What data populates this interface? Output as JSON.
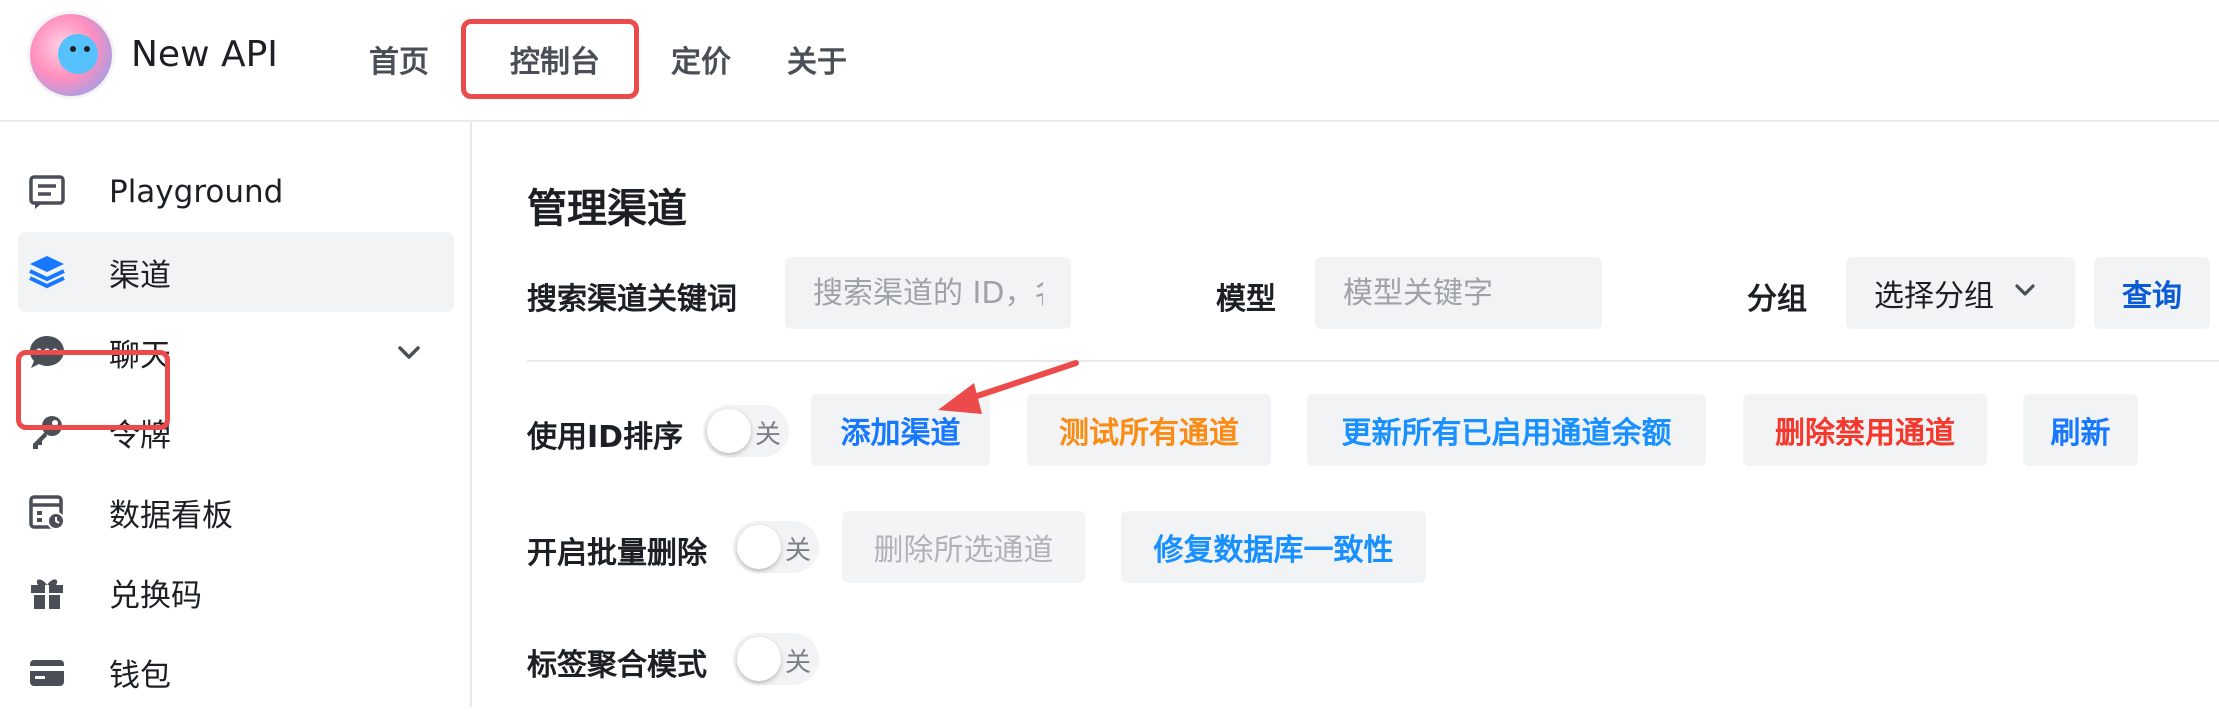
{
  "app": {
    "brand": "New API"
  },
  "topnav": {
    "items": [
      {
        "label": "首页"
      },
      {
        "label": "控制台",
        "active": true
      },
      {
        "label": "定价"
      },
      {
        "label": "关于"
      }
    ]
  },
  "sidebar": {
    "items": [
      {
        "label": "Playground",
        "icon": "chat-square-icon"
      },
      {
        "label": "渠道",
        "icon": "layers-icon",
        "active": true
      },
      {
        "label": "聊天",
        "icon": "chat-bubble-icon",
        "expandable": true
      },
      {
        "label": "令牌",
        "icon": "key-icon"
      },
      {
        "label": "数据看板",
        "icon": "dashboard-icon"
      },
      {
        "label": "兑换码",
        "icon": "gift-icon"
      },
      {
        "label": "钱包",
        "icon": "wallet-icon"
      }
    ]
  },
  "main": {
    "title": "管理渠道",
    "filters": {
      "keyword_label": "搜索渠道关键词",
      "keyword_placeholder": "搜索渠道的 ID，名称和密钥 ...",
      "model_label": "模型",
      "model_placeholder": "模型关键字",
      "group_label": "分组",
      "group_value": "选择分组",
      "query_button": "查询"
    },
    "row1": {
      "sort_label": "使用ID排序",
      "sort_switch_state": "关",
      "add_channel": "添加渠道",
      "test_all": "测试所有通道",
      "update_balance": "更新所有已启用通道余额",
      "delete_disabled": "删除禁用通道",
      "refresh": "刷新"
    },
    "row2": {
      "batch_delete_label": "开启批量删除",
      "batch_switch_state": "关",
      "delete_selected": "删除所选通道",
      "fix_db": "修复数据库一致性"
    },
    "row3": {
      "tag_mode_label": "标签聚合模式",
      "tag_switch_state": "关"
    }
  },
  "colors": {
    "highlight_red": "#ec4b4b",
    "primary_blue": "#1677ff",
    "warning_orange": "#fa8c16",
    "danger_red": "#f5382c"
  }
}
